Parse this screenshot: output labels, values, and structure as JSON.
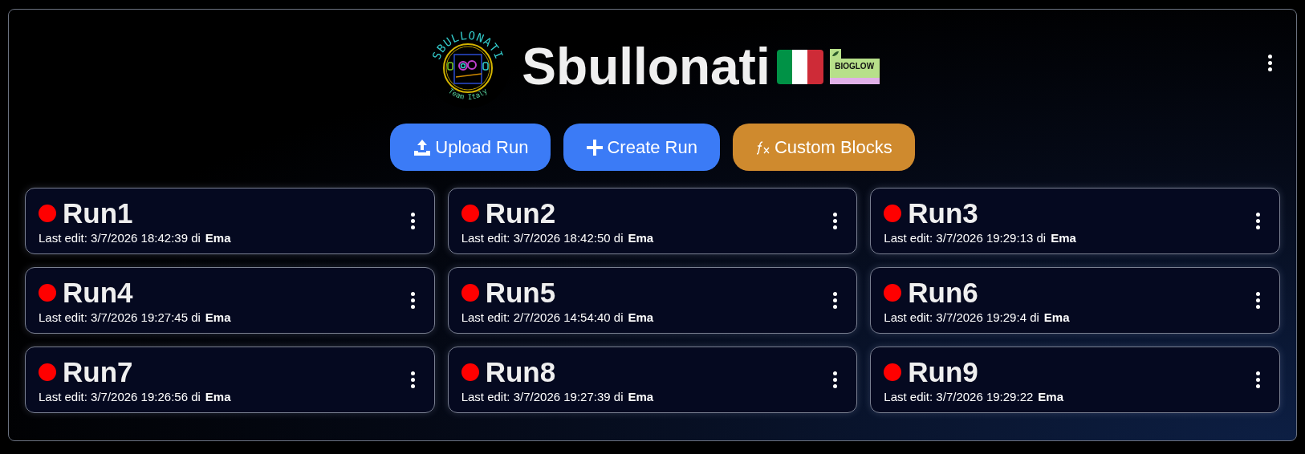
{
  "header": {
    "logo": {
      "arc_text": "SBULLONATI",
      "tagline": "Team Italy"
    },
    "title": "Sbullonati",
    "sponsor": {
      "name": "BIOGLOW"
    }
  },
  "actions": [
    {
      "label": "Upload Run",
      "kind": "upload"
    },
    {
      "label": "Create Run",
      "kind": "create"
    },
    {
      "label": "Custom Blocks",
      "kind": "custom"
    }
  ],
  "runs": [
    {
      "name": "Run1",
      "color": "#ff0000",
      "edited": "Last edit: 3/7/2026 18:42:39 di",
      "author": "Ema"
    },
    {
      "name": "Run2",
      "color": "#ff0000",
      "edited": "Last edit: 3/7/2026 18:42:50 di",
      "author": "Ema"
    },
    {
      "name": "Run3",
      "color": "#ff0000",
      "edited": "Last edit: 3/7/2026 19:29:13 di",
      "author": "Ema"
    },
    {
      "name": "Run4",
      "color": "#ff0000",
      "edited": "Last edit: 3/7/2026 19:27:45 di",
      "author": "Ema"
    },
    {
      "name": "Run5",
      "color": "#ff0000",
      "edited": "Last edit: 2/7/2026 14:54:40 di",
      "author": "Ema"
    },
    {
      "name": "Run6",
      "color": "#ff0000",
      "edited": "Last edit: 3/7/2026 19:29:4 di",
      "author": "Ema"
    },
    {
      "name": "Run7",
      "color": "#ff0000",
      "edited": "Last edit: 3/7/2026 19:26:56 di",
      "author": "Ema"
    },
    {
      "name": "Run8",
      "color": "#ff0000",
      "edited": "Last edit: 3/7/2026 19:27:39 di",
      "author": "Ema"
    },
    {
      "name": "Run9",
      "color": "#ff0000",
      "edited": "Last edit: 3/7/2026 19:29:22",
      "author": "Ema"
    }
  ]
}
